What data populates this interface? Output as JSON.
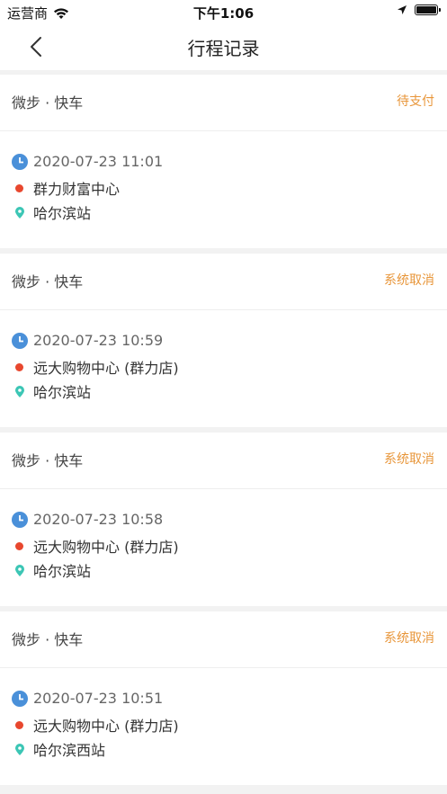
{
  "status_bar": {
    "carrier": "运营商",
    "time": "下午1:06"
  },
  "header": {
    "title": "行程记录"
  },
  "colors": {
    "accent": "#e8963a",
    "origin_dot": "#e8472e",
    "destination_pin": "#3cc6b5",
    "clock": "#4a90d9"
  },
  "trips": [
    {
      "service": "微步 · 快车",
      "status": "待支付",
      "datetime": "2020-07-23 11:01",
      "from": "群力财富中心",
      "to": "哈尔滨站"
    },
    {
      "service": "微步 · 快车",
      "status": "系统取消",
      "datetime": "2020-07-23 10:59",
      "from": "远大购物中心 (群力店)",
      "to": "哈尔滨站"
    },
    {
      "service": "微步 · 快车",
      "status": "系统取消",
      "datetime": "2020-07-23 10:58",
      "from": "远大购物中心 (群力店)",
      "to": "哈尔滨站"
    },
    {
      "service": "微步 · 快车",
      "status": "系统取消",
      "datetime": "2020-07-23 10:51",
      "from": "远大购物中心 (群力店)",
      "to": "哈尔滨西站"
    }
  ]
}
